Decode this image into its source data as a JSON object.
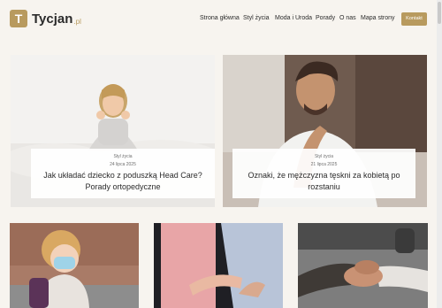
{
  "header": {
    "logo_letter": "T",
    "logo_name": "Tycjan",
    "logo_tld": ".pl",
    "nav": [
      "Strona główna",
      "Styl życia",
      "Moda i Uroda",
      "Porady",
      "O nas",
      "Mapa strony"
    ],
    "contact_label": "Kontakt"
  },
  "featured": [
    {
      "category": "Styl życia",
      "date": "24 lipca 2025",
      "title": "Jak układać dziecko z poduszką Head Care? Porady ortopedyczne"
    },
    {
      "category": "Styl życia",
      "date": "21 lipca 2025",
      "title": "Oznaki, że mężczyzna tęskni za kobietą po rozstaniu"
    }
  ],
  "colors": {
    "accent": "#b89a5e",
    "background": "#f7f4ef"
  }
}
